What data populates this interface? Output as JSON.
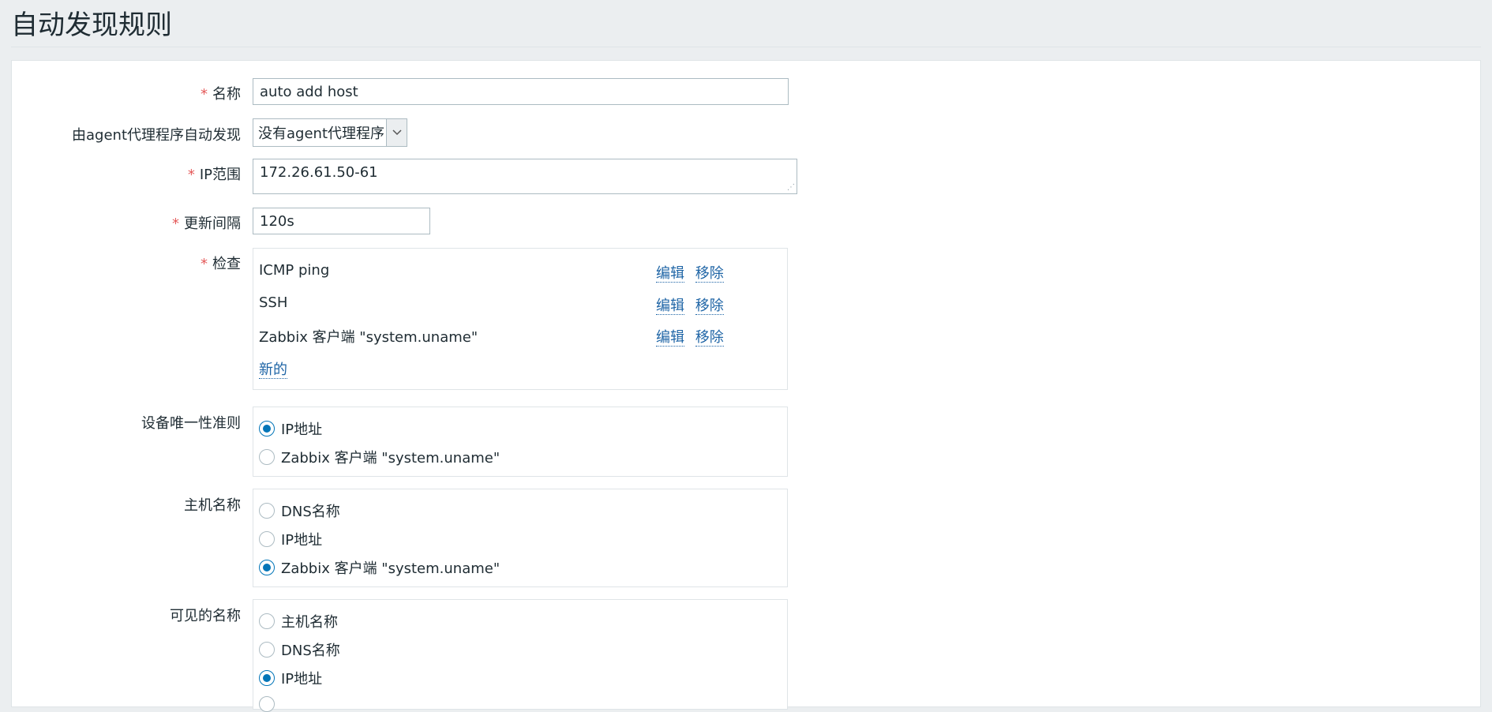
{
  "page": {
    "title": "自动发现规则"
  },
  "form": {
    "name": {
      "label": "名称",
      "value": "auto add host"
    },
    "proxy": {
      "label": "由agent代理程序自动发现",
      "selected": "没有agent代理程序"
    },
    "ip_range": {
      "label": "IP范围",
      "value": "172.26.61.50-61"
    },
    "interval": {
      "label": "更新间隔",
      "value": "120s"
    },
    "checks": {
      "label": "检查",
      "items": [
        {
          "name": "ICMP ping",
          "edit": "编辑",
          "remove": "移除"
        },
        {
          "name": "SSH",
          "edit": "编辑",
          "remove": "移除"
        },
        {
          "name": "Zabbix 客户端 \"system.uname\"",
          "edit": "编辑",
          "remove": "移除"
        }
      ],
      "new_label": "新的"
    },
    "uniqueness": {
      "label": "设备唯一性准则",
      "options": [
        "IP地址",
        "Zabbix 客户端 \"system.uname\""
      ],
      "selected_index": 0
    },
    "host_name": {
      "label": "主机名称",
      "options": [
        "DNS名称",
        "IP地址",
        "Zabbix 客户端 \"system.uname\""
      ],
      "selected_index": 2
    },
    "visible_name": {
      "label": "可见的名称",
      "options": [
        "主机名称",
        "DNS名称",
        "IP地址"
      ],
      "selected_index": 2
    }
  },
  "colors": {
    "accent": "#0275b8",
    "link": "#1f65a6",
    "required": "#e45959",
    "background": "#ebeef0"
  }
}
